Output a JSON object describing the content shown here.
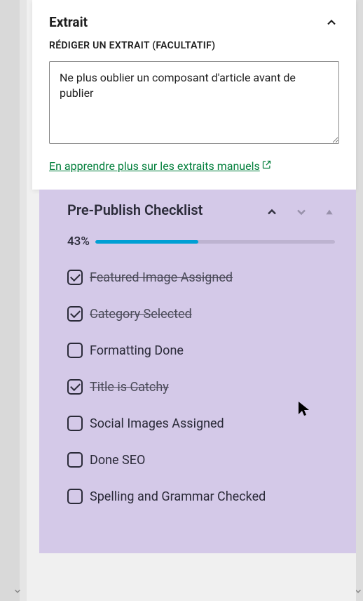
{
  "extrait": {
    "title": "Extrait",
    "label": "RÉDIGER UN EXTRAIT (FACULTATIF)",
    "text": "Ne plus oublier un composant d'article avant de publier",
    "link_text": "En apprendre plus sur les extraits manuels"
  },
  "checklist": {
    "title": "Pre-Publish Checklist",
    "percent_label": "43%",
    "percent_value": 43,
    "items": [
      {
        "label": "Featured Image Assigned",
        "checked": true
      },
      {
        "label": "Category Selected",
        "checked": true
      },
      {
        "label": "Formatting Done",
        "checked": false
      },
      {
        "label": "Title is Catchy",
        "checked": true
      },
      {
        "label": "Social Images Assigned",
        "checked": false
      },
      {
        "label": "Done SEO",
        "checked": false
      },
      {
        "label": "Spelling and Grammar Checked",
        "checked": false
      }
    ]
  }
}
